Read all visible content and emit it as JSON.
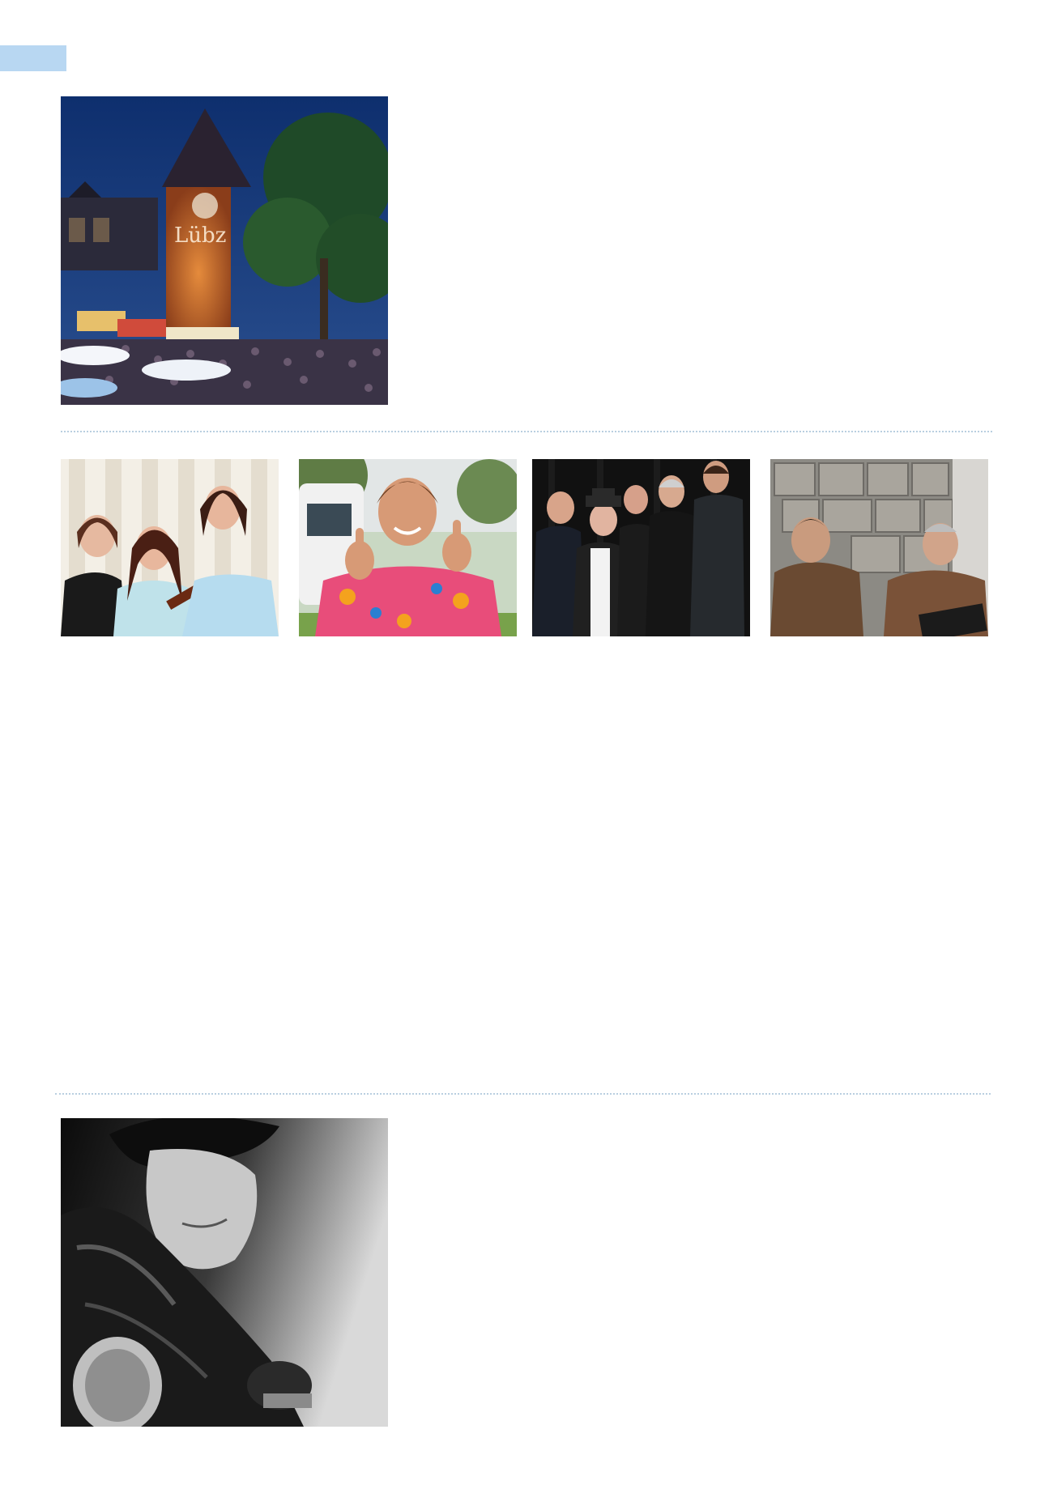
{
  "page": {
    "accent_color": "#b8d7f2",
    "divider_color": "#b9cfe0"
  },
  "photos": [
    {
      "id": "festival",
      "depicts": "illuminated-tower-festival-crowd"
    },
    {
      "id": "trio",
      "depicts": "three-women-musicians"
    },
    {
      "id": "thumbs",
      "depicts": "man-hawaiian-shirt-thumbs-up"
    },
    {
      "id": "band",
      "depicts": "five-person-band"
    },
    {
      "id": "monks",
      "depicts": "two-singing-monks"
    },
    {
      "id": "elvis",
      "depicts": "black-white-singer-portrait"
    }
  ]
}
